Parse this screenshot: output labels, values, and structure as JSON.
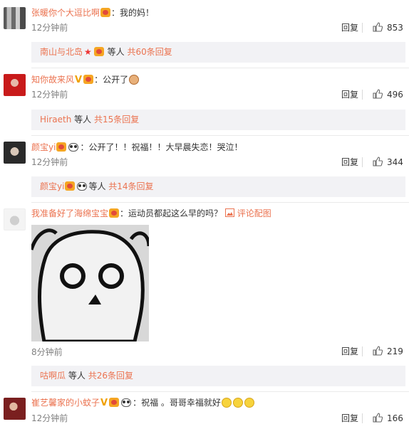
{
  "comments": [
    {
      "user": "张暖你个大逗比啊",
      "text": "：我的妈！",
      "time": "12分钟前",
      "reply": "回复",
      "likes": "853",
      "sub": {
        "user": "南山与北岛",
        "middle": "等人",
        "link": "共60条回复"
      }
    },
    {
      "user": "知你故来风",
      "text": "：公开了",
      "time": "12分钟前",
      "reply": "回复",
      "likes": "496",
      "sub": {
        "user": "Hiraeth",
        "middle": "等人",
        "link": "共15条回复"
      }
    },
    {
      "user": "颜宝yi",
      "text": "：公开了！！祝福！！大早晨失恋！哭泣！",
      "time": "12分钟前",
      "reply": "回复",
      "likes": "344",
      "sub": {
        "user": "颜宝yi",
        "middle": "等人",
        "link": "共14条回复"
      }
    },
    {
      "user": "我准备好了海绵宝宝",
      "text": "：运动员都起这么早的吗？",
      "pic_link": "评论配图",
      "time": "8分钟前",
      "reply": "回复",
      "likes": "219",
      "sub": {
        "user": "咕啊瓜",
        "middle": "等人",
        "link": "共26条回复"
      }
    },
    {
      "user": "崔艺馨家的小蚊子",
      "text": "：祝福 。哥哥幸福就好",
      "time": "12分钟前",
      "reply": "回复",
      "likes": "166"
    }
  ],
  "icons": {
    "like": "thumbs-up-icon",
    "badge": "member-badge-icon",
    "panda": "panda-emoji-icon",
    "smile": "smile-emoji-icon",
    "vip": "verified-v-icon",
    "image": "image-icon"
  }
}
